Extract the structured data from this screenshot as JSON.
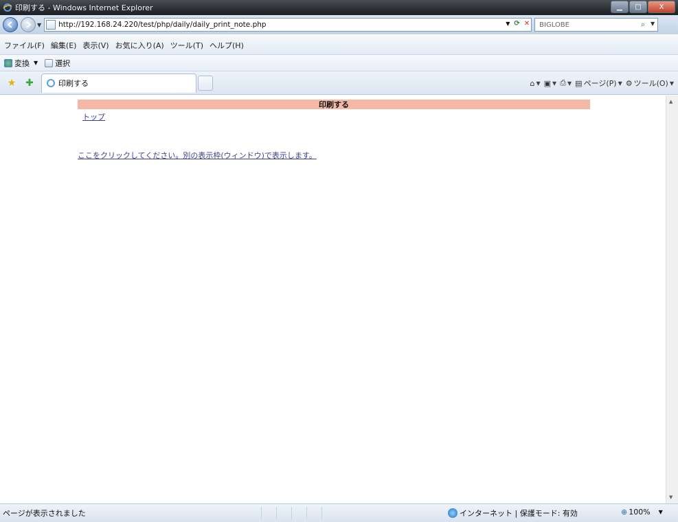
{
  "window": {
    "title": "印刷する - Windows Internet Explorer",
    "controls": {
      "minimize": "▁",
      "maximize": "□",
      "close": "X"
    }
  },
  "address": {
    "url": "http://192.168.24.220/test/php/daily/daily_print_note.php",
    "search_provider": "BIGLOBE"
  },
  "menu": {
    "items": [
      "ファイル(F)",
      "編集(E)",
      "表示(V)",
      "お気に入り(A)",
      "ツール(T)",
      "ヘルプ(H)"
    ]
  },
  "toolbar2": {
    "convert_label": "変換",
    "select_label": "選択"
  },
  "tabs": {
    "active_tab_label": "印刷する"
  },
  "commands": {
    "page_label": "ページ(P)",
    "tools_label": "ツール(O)"
  },
  "content": {
    "header_title": "印刷する",
    "top_link": "トップ",
    "main_link": "ここをクリックしてください。別の表示枠(ウィンドウ)で表示します。"
  },
  "status": {
    "message": "ページが表示されました",
    "zone": "インターネット | 保護モード: 有効",
    "zoom": "100%"
  },
  "colors": {
    "header_bar": "#f4b9a6",
    "link": "#3b3e8a",
    "titlebar": "#2b2f33"
  },
  "icons": [
    "ie-icon",
    "back-icon",
    "forward-icon",
    "page-icon",
    "refresh-icon",
    "stop-icon",
    "search-icon",
    "favorites-star-icon",
    "add-favorites-icon",
    "home-icon",
    "feeds-icon",
    "print-icon",
    "page-menu-icon",
    "tools-gear-icon",
    "internet-zone-icon",
    "zoom-icon"
  ]
}
